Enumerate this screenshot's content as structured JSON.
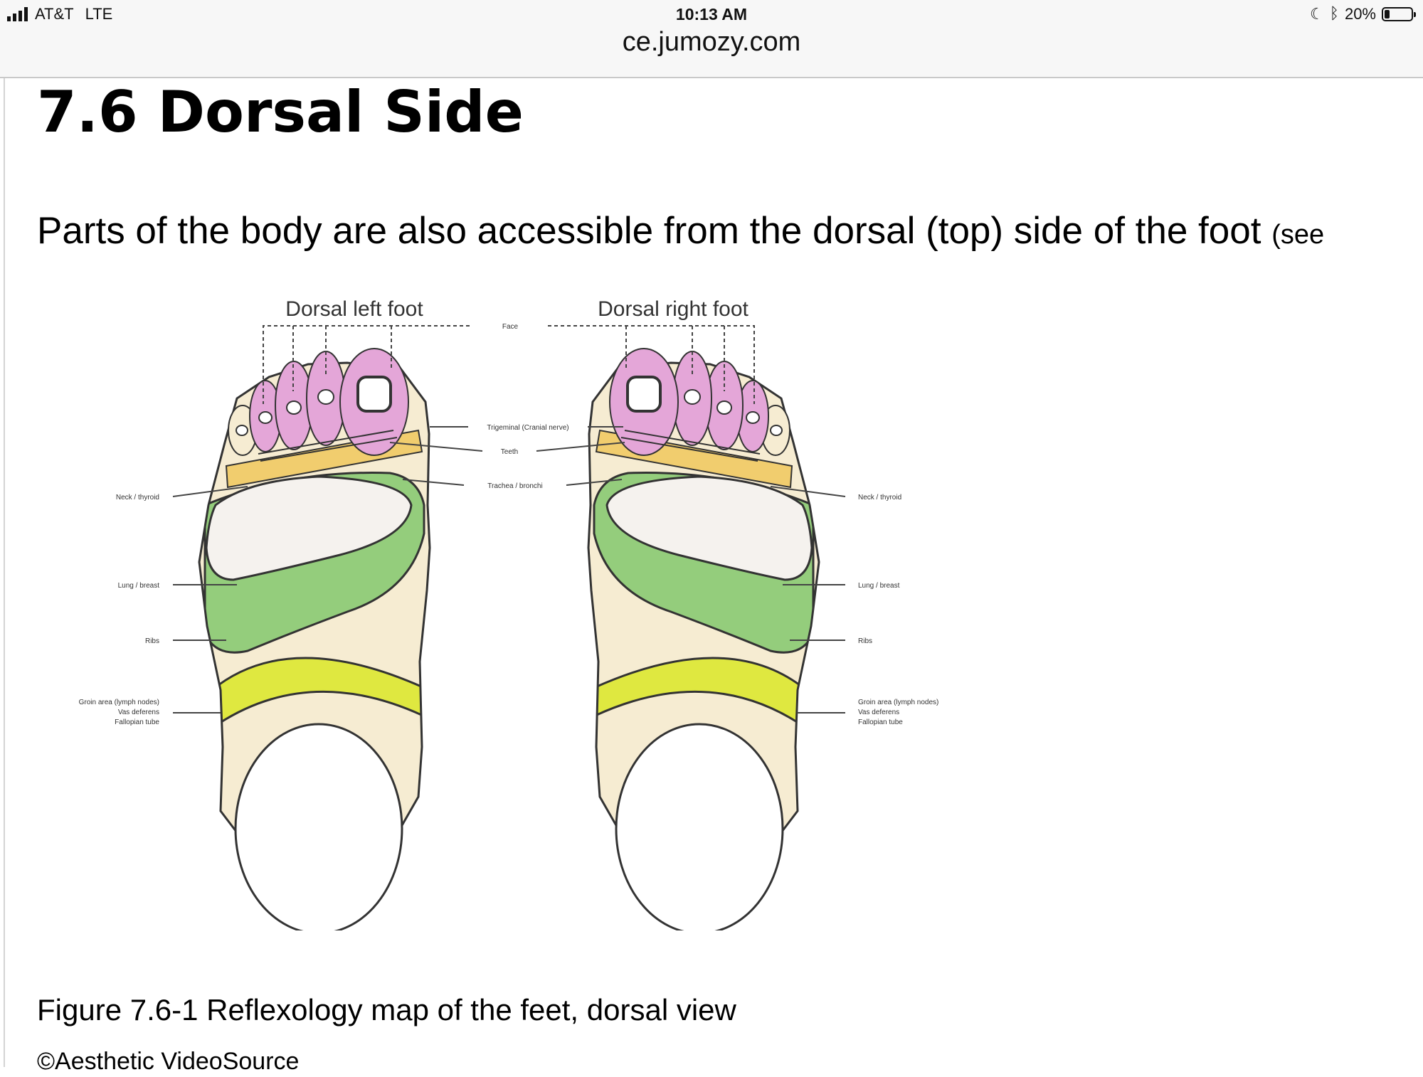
{
  "status_bar": {
    "carrier": "AT&T",
    "network": "LTE",
    "time": "10:13 AM",
    "battery": "20%",
    "battery_level": 0.2
  },
  "browser": {
    "url": "ce.jumozy.com"
  },
  "article": {
    "heading": "7.6 Dorsal Side",
    "intro": "Parts of the body are also accessible from the dorsal (top) side of the foot",
    "intro_aside": "(see"
  },
  "figure": {
    "left_title": "Dorsal left foot",
    "right_title": "Dorsal right foot",
    "labels": {
      "face": "Face",
      "trigeminal": "Trigeminal (Cranial nerve)",
      "teeth": "Teeth",
      "trachea": "Trachea / bronchi",
      "neck": "Neck / thyroid",
      "lung": "Lung / breast",
      "ribs": "Ribs",
      "groin_1": "Groin area (lymph nodes)",
      "groin_2": "Vas deferens",
      "groin_3": "Fallopian tube"
    },
    "colors": {
      "skin": "#f6ecd2",
      "toes": "#e4a6d8",
      "lung_band": "#94cd7c",
      "lung_core": "#f5f2ee",
      "groin_band": "#dfe840",
      "neck_band": "#f1cd6e",
      "outline": "#333333"
    }
  },
  "caption": "Figure 7.6-1 Reflexology map of the feet, dorsal view",
  "credit": "©Aesthetic VideoSource"
}
